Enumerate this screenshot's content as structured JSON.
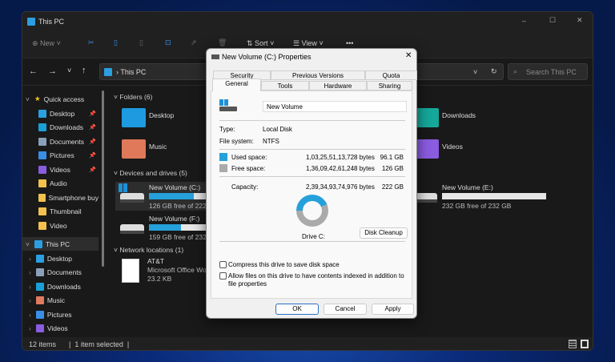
{
  "window": {
    "title": "This PC",
    "controls": {
      "minimize": "–",
      "maximize": "☐",
      "close": "✕"
    }
  },
  "toolbar": {
    "new": "New",
    "sort": "Sort",
    "view": "View",
    "more": "•••"
  },
  "address": {
    "path": "This PC",
    "search_placeholder": "Search This PC"
  },
  "sidebar": {
    "quick_access": "Quick access",
    "quick_items": [
      {
        "label": "Desktop",
        "color": "#2b9fe0",
        "pinned": true
      },
      {
        "label": "Downloads",
        "color": "#1aa0d8",
        "pinned": true
      },
      {
        "label": "Documents",
        "color": "#8aa0b8",
        "pinned": true
      },
      {
        "label": "Pictures",
        "color": "#3a8ee6",
        "pinned": true
      },
      {
        "label": "Videos",
        "color": "#8a5ce0",
        "pinned": true
      },
      {
        "label": "Audio",
        "color": "#f2c14e"
      },
      {
        "label": "Smartphone buy",
        "color": "#f2c14e"
      },
      {
        "label": "Thumbnail",
        "color": "#f2c14e"
      },
      {
        "label": "Video",
        "color": "#f2c14e"
      }
    ],
    "this_pc": "This PC",
    "pc_items": [
      {
        "label": "Desktop",
        "color": "#2b9fe0"
      },
      {
        "label": "Documents",
        "color": "#8aa0b8"
      },
      {
        "label": "Downloads",
        "color": "#1aa0d8"
      },
      {
        "label": "Music",
        "color": "#e07a5f"
      },
      {
        "label": "Pictures",
        "color": "#3a8ee6"
      },
      {
        "label": "Videos",
        "color": "#8a5ce0"
      }
    ]
  },
  "main": {
    "folders_header": "Folders (6)",
    "folders": [
      {
        "label": "Desktop",
        "color": "#1e9be0"
      },
      {
        "label": "Music",
        "color": "#e0785a"
      },
      {
        "label": "Downloads",
        "color": "#14a89a"
      },
      {
        "label": "Videos",
        "color": "#8a5ce0"
      }
    ],
    "drives_header": "Devices and drives (5)",
    "drives": [
      {
        "name": "New Volume (C:)",
        "free": "126 GB free of 222 GB",
        "used_fraction": 0.43
      },
      {
        "name": "New Volume (F:)",
        "free": "159 GB free of 232 GB",
        "used_fraction": 0.31
      },
      {
        "name": "New Volume (E:)",
        "free": "232 GB free of 232 GB",
        "used_fraction": 0.0
      }
    ],
    "network_header": "Network locations (1)",
    "network": {
      "name": "AT&T",
      "type": "Microsoft Office Wo",
      "size": "23.2 KB"
    }
  },
  "status": {
    "items": "12 items",
    "selected": "1 item selected"
  },
  "dialog": {
    "title": "New Volume (C:) Properties",
    "tabs_top": [
      "Security",
      "Previous Versions",
      "Quota"
    ],
    "tabs_bottom": [
      "General",
      "Tools",
      "Hardware",
      "Sharing"
    ],
    "volume_name": "New Volume",
    "type_label": "Type:",
    "type_value": "Local Disk",
    "fs_label": "File system:",
    "fs_value": "NTFS",
    "used_label": "Used space:",
    "used_bytes": "1,03,25,51,13,728 bytes",
    "used_gb": "96.1 GB",
    "free_label": "Free space:",
    "free_bytes": "1,36,09,42,61,248 bytes",
    "free_gb": "126 GB",
    "cap_label": "Capacity:",
    "cap_bytes": "2,39,34,93,74,976 bytes",
    "cap_gb": "222 GB",
    "used_fraction": 0.434,
    "used_color": "#26a0da",
    "free_color": "#aaaaaa",
    "drive_label": "Drive C:",
    "cleanup": "Disk Cleanup",
    "compress": "Compress this drive to save disk space",
    "index": "Allow files on this drive to have contents indexed in addition to file properties",
    "ok": "OK",
    "cancel": "Cancel",
    "apply": "Apply"
  }
}
